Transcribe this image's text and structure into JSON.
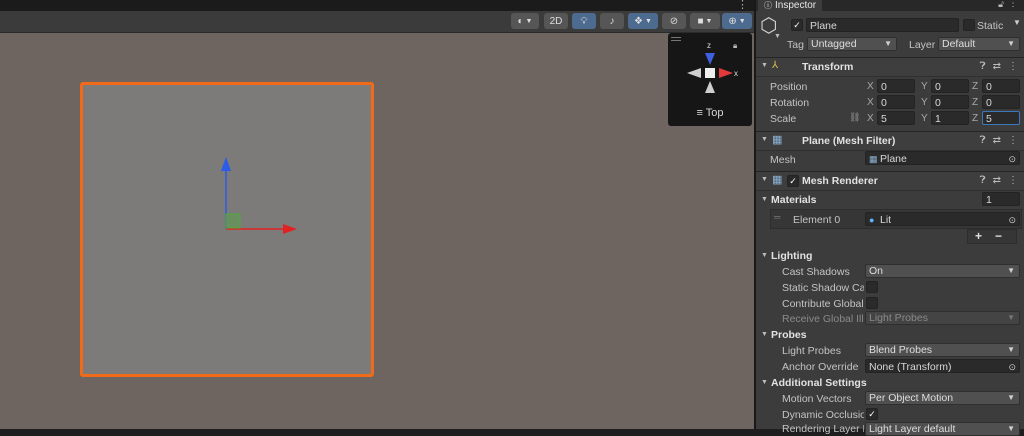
{
  "scene": {
    "toolbar": {
      "mode_2d": "2D"
    },
    "gizmo": {
      "view_label": "Top",
      "axis_z": "z",
      "axis_x": "x"
    },
    "colors": {
      "selection_outline": "#f06a18",
      "x_axis": "#e22222",
      "y_axis": "#2a5ce8",
      "z_handle": "#4fa83a"
    }
  },
  "inspector": {
    "tab_title": "Inspector",
    "object_name": "Plane",
    "static_label": "Static",
    "tag_label": "Tag",
    "tag_value": "Untagged",
    "layer_label": "Layer",
    "layer_value": "Default",
    "transform": {
      "title": "Transform",
      "position_label": "Position",
      "rotation_label": "Rotation",
      "scale_label": "Scale",
      "position": {
        "x": "0",
        "y": "0",
        "z": "0"
      },
      "rotation": {
        "x": "0",
        "y": "0",
        "z": "0"
      },
      "scale": {
        "x": "5",
        "y": "1",
        "z": "5"
      }
    },
    "mesh_filter": {
      "title": "Plane (Mesh Filter)",
      "mesh_label": "Mesh",
      "mesh_value": "Plane"
    },
    "mesh_renderer": {
      "title": "Mesh Renderer",
      "materials_label": "Materials",
      "materials_count": "1",
      "element_label": "Element 0",
      "element_value": "Lit",
      "add_label": "+",
      "remove_label": "−",
      "lighting_label": "Lighting",
      "cast_shadows_label": "Cast Shadows",
      "cast_shadows_value": "On",
      "static_shadow_label": "Static Shadow Cas",
      "contribute_gi_label": "Contribute Global I",
      "receive_gi_label": "Receive Global Illu",
      "receive_gi_value": "Light Probes",
      "probes_label": "Probes",
      "light_probes_label": "Light Probes",
      "light_probes_value": "Blend Probes",
      "anchor_label": "Anchor Override",
      "anchor_value": "None (Transform)",
      "additional_label": "Additional Settings",
      "motion_vectors_label": "Motion Vectors",
      "motion_vectors_value": "Per Object Motion",
      "dynamic_occlusion_label": "Dynamic Occlusio",
      "rendering_layer_label": "Rendering Layer M",
      "rendering_layer_value": "Light Layer default"
    }
  }
}
